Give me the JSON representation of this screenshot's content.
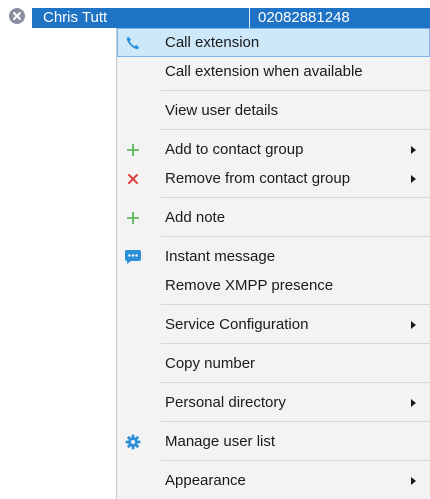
{
  "contact_row": {
    "name": "Chris Tutt",
    "number": "02082881248"
  },
  "menu": {
    "call_extension": "Call extension",
    "call_extension_when_available": "Call extension when available",
    "view_user_details": "View user details",
    "add_to_contact_group": "Add to contact group",
    "remove_from_contact_group": "Remove from contact group",
    "add_note": "Add note",
    "instant_message": "Instant message",
    "remove_xmpp_presence": "Remove XMPP presence",
    "service_configuration": "Service Configuration",
    "copy_number": "Copy number",
    "personal_directory": "Personal directory",
    "manage_user_list": "Manage user list",
    "appearance": "Appearance"
  },
  "icons": {
    "status": "offline-x-icon",
    "call": "phone-handset-icon",
    "add": "plus-icon",
    "remove": "red-x-icon",
    "message": "chat-bubble-icon",
    "manage": "gear-icon"
  },
  "colors": {
    "selection": "#1f73c4",
    "highlight": "#cde8f9",
    "highlight_border": "#7eb4ea",
    "plus_green": "#5cb85c",
    "x_red": "#e04040",
    "accent_blue": "#2a8fd6"
  }
}
